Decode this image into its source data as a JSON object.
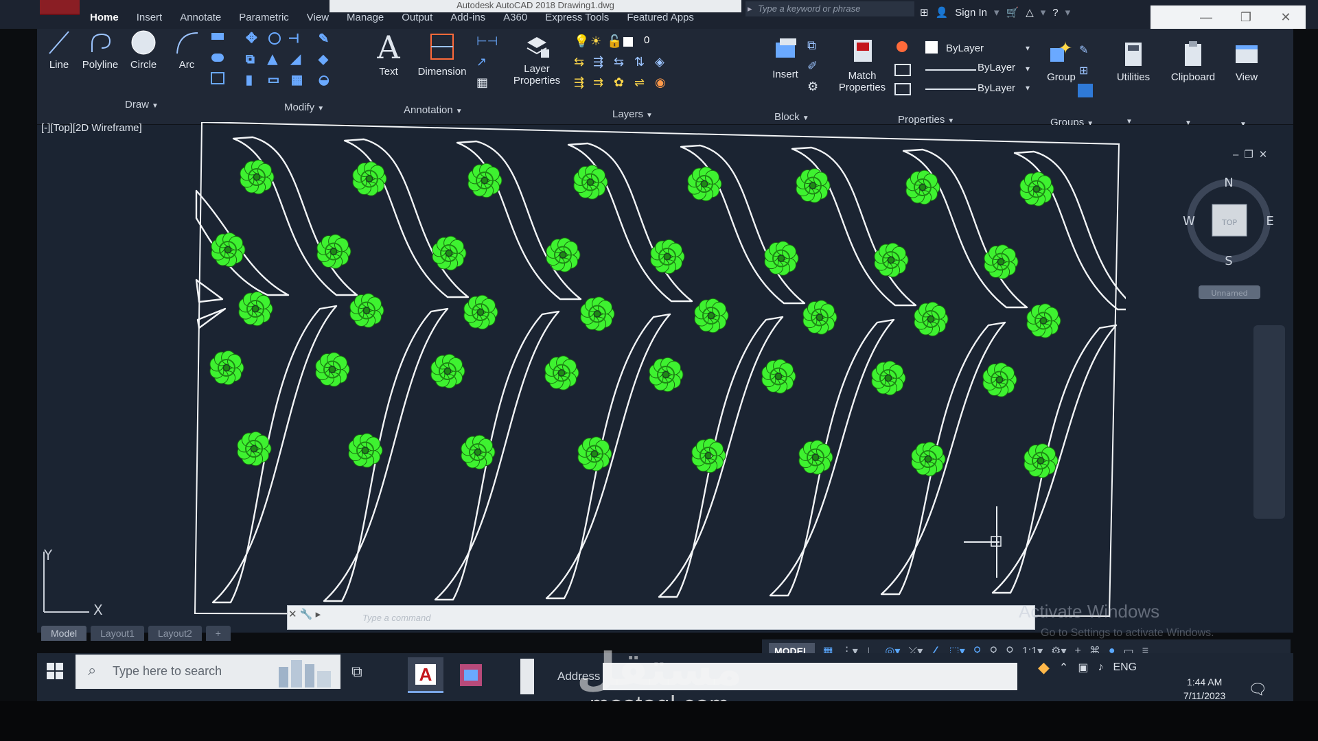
{
  "window": {
    "title": "Autodesk AutoCAD 2018   Drawing1.dwg",
    "search_placeholder": "Type a keyword or phrase",
    "sign_in": "Sign In"
  },
  "ribbon_tabs": [
    "Home",
    "Insert",
    "Annotate",
    "Parametric",
    "View",
    "Manage",
    "Output",
    "Add-ins",
    "A360",
    "Express Tools",
    "Featured Apps"
  ],
  "ribbon": {
    "draw": {
      "line": "Line",
      "polyline": "Polyline",
      "circle": "Circle",
      "arc": "Arc",
      "panel": "Draw"
    },
    "modify": {
      "panel": "Modify"
    },
    "annotation": {
      "text": "Text",
      "dimension": "Dimension",
      "panel": "Annotation"
    },
    "layers": {
      "layer_properties_1": "Layer",
      "layer_properties_2": "Properties",
      "current_layer": "0",
      "panel": "Layers"
    },
    "block": {
      "insert": "Insert",
      "panel": "Block"
    },
    "properties": {
      "match_1": "Match",
      "match_2": "Properties",
      "color": "ByLayer",
      "linetype": "ByLayer",
      "lineweight": "ByLayer",
      "panel": "Properties"
    },
    "groups": {
      "group": "Group",
      "panel": "Groups"
    },
    "utilities": "Utilities",
    "clipboard": "Clipboard",
    "view": "View"
  },
  "viewport": {
    "label": "[-][Top][2D Wireframe]"
  },
  "viewcube": {
    "north": "N",
    "south": "S",
    "east": "E",
    "west": "W",
    "face": "TOP",
    "wcs": "Unnamed"
  },
  "ucs": {
    "y": "Y",
    "x": "X"
  },
  "command": {
    "placeholder": "Type a command"
  },
  "layout_tabs": [
    "Model",
    "Layout1",
    "Layout2",
    "+"
  ],
  "status": {
    "model": "MODEL"
  },
  "activation": {
    "title": "Activate Windows",
    "subtitle": "Go to Settings to activate Windows."
  },
  "taskbar": {
    "search_placeholder": "Type here to search",
    "address_label": "Address",
    "language": "ENG",
    "time": "1:44 AM",
    "date": "7/11/2023"
  },
  "watermark": {
    "arabic": "مستقل",
    "latin": "mostaql.com"
  },
  "colors": {
    "plant": "#3ef230",
    "line": "#f2f4f6",
    "workspace": "#1b2432"
  }
}
